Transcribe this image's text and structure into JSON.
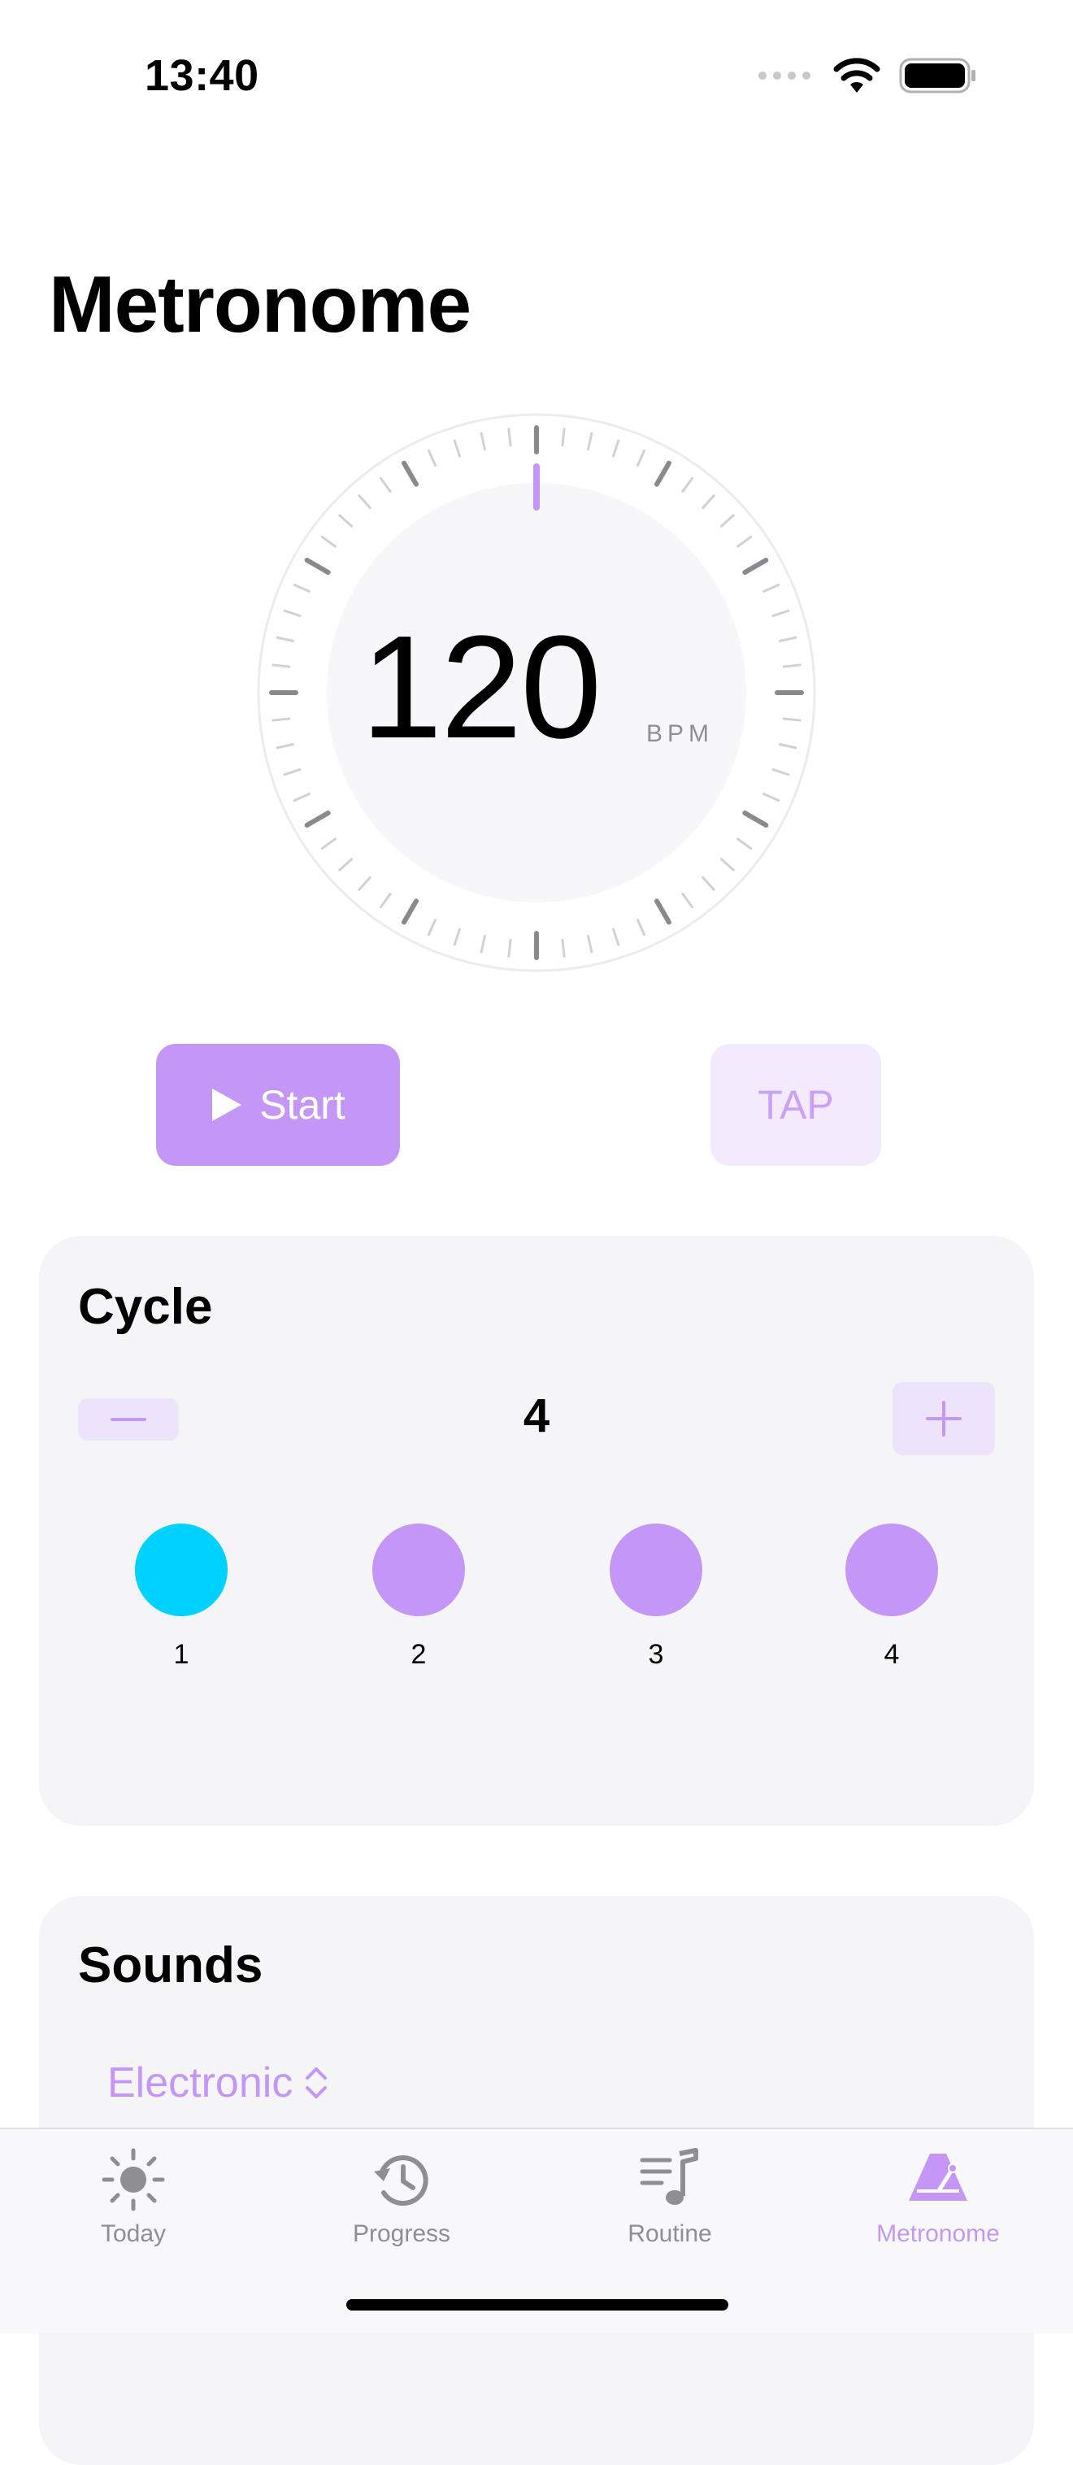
{
  "status_bar": {
    "time": "13:40"
  },
  "page_title": "Metronome",
  "tempo": {
    "value": "120",
    "unit": "BPM"
  },
  "controls": {
    "start_label": "Start",
    "tap_label": "TAP"
  },
  "cycle": {
    "title": "Cycle",
    "count": "4",
    "beats": [
      {
        "label": "1",
        "color": "#00d2ff"
      },
      {
        "label": "2",
        "color": "#c497f7"
      },
      {
        "label": "3",
        "color": "#c497f7"
      },
      {
        "label": "4",
        "color": "#c497f7"
      }
    ]
  },
  "sounds": {
    "title": "Sounds",
    "selected": "Electronic"
  },
  "tabs": [
    {
      "label": "Today",
      "icon": "sun-icon",
      "active": false
    },
    {
      "label": "Progress",
      "icon": "history-icon",
      "active": false
    },
    {
      "label": "Routine",
      "icon": "music-list-icon",
      "active": false
    },
    {
      "label": "Metronome",
      "icon": "metronome-icon",
      "active": true
    }
  ],
  "colors": {
    "accent": "#c497f7",
    "accent_light": "#f3eafd",
    "first_beat": "#00d2ff",
    "card": "#f5f5f7"
  }
}
